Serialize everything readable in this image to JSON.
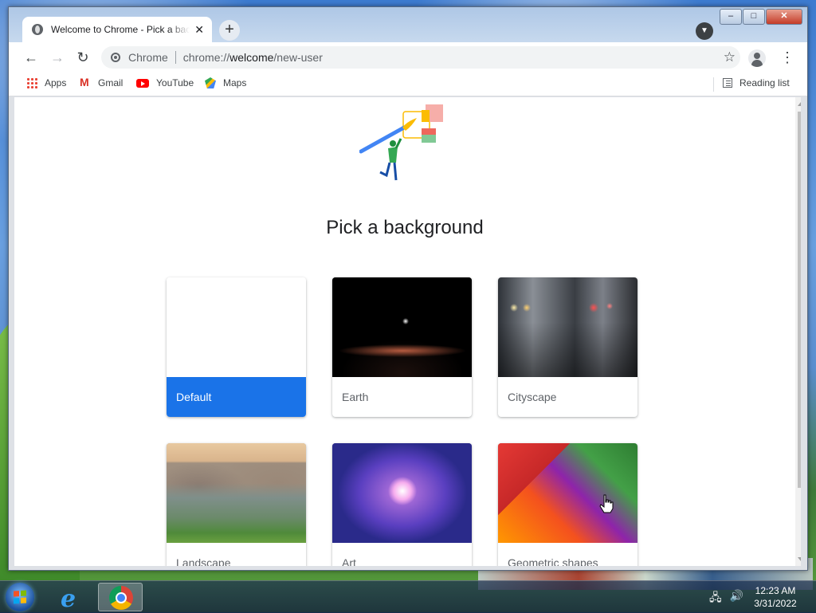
{
  "window": {
    "tab_title": "Welcome to Chrome - Pick a background",
    "tab_close": "✕",
    "new_tab": "+",
    "controls": {
      "minimize": "–",
      "maximize": "□",
      "close": "✕"
    }
  },
  "toolbar": {
    "back": "←",
    "forward": "→",
    "reload": "↻",
    "omnibox_label": "Chrome",
    "url_prefix": "chrome://",
    "url_host": "welcome",
    "url_path": "/new-user",
    "star": "☆",
    "menu": "⋮"
  },
  "bookmarks": {
    "items": [
      {
        "label": "Apps",
        "icon": "apps-icon"
      },
      {
        "label": "Gmail",
        "icon": "gmail-icon"
      },
      {
        "label": "YouTube",
        "icon": "youtube-icon"
      },
      {
        "label": "Maps",
        "icon": "maps-icon"
      }
    ],
    "reading_list": "Reading list"
  },
  "page": {
    "heading": "Pick a background",
    "backgrounds": [
      {
        "label": "Default",
        "selected": true
      },
      {
        "label": "Earth",
        "selected": false
      },
      {
        "label": "Cityscape",
        "selected": false
      },
      {
        "label": "Landscape",
        "selected": false
      },
      {
        "label": "Art",
        "selected": false
      },
      {
        "label": "Geometric shapes",
        "selected": false
      }
    ]
  },
  "colors": {
    "accent": "#1a73e8",
    "card_text": "#5f6368",
    "heading": "#202124"
  },
  "taskbar": {
    "time": "12:23 AM",
    "date": "3/31/2022"
  }
}
